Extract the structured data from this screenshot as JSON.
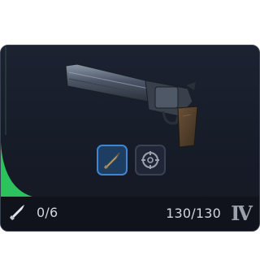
{
  "card": {
    "accent_color": "#2ec25e",
    "background": "#1a1f2b",
    "weapon_image": "revolver-long-barrel",
    "attachments": [
      {
        "icon": "bullet-icon",
        "state": "equipped"
      },
      {
        "icon": "crosshair-scope-icon",
        "state": "empty"
      }
    ],
    "ammo": {
      "icon": "bullet-icon",
      "text": "0/6"
    },
    "durability": {
      "text": "130/130"
    },
    "tier": {
      "label": "IV"
    }
  }
}
